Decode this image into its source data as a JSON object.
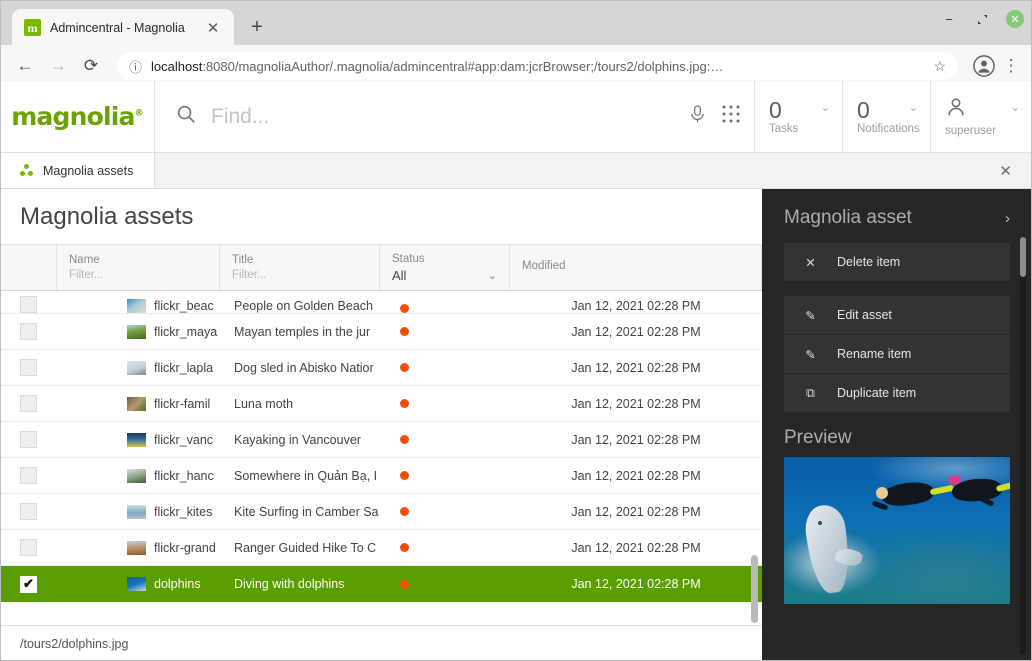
{
  "browser": {
    "tab": {
      "title": "Admincentral - Magnolia",
      "favicon_letter": "m",
      "favicon_color": "#7bb800",
      "close_label": "✕"
    },
    "new_tab_label": "+",
    "window_controls": {
      "minimize": "−",
      "maximize": "❐",
      "close": "✕"
    },
    "nav": {
      "back": "←",
      "forward": "→",
      "reload": "⟳"
    },
    "omnibox": {
      "info_icon": "ⓘ",
      "url_bold": "localhost",
      "url_rest": ":8080/magnoliaAuthor/.magnolia/admincentral#app:dam:jcrBrowser;/tours2/dolphins.jpg:…",
      "star": "☆"
    },
    "menu": "⋮"
  },
  "app": {
    "logo": {
      "text": "magnolia",
      "mark": "®",
      "color": "#6ba400"
    },
    "search": {
      "placeholder": "Find...",
      "icon": "search-icon"
    },
    "header_icons": {
      "mic": "mic-icon",
      "apps": "apps-grid-icon"
    },
    "header_cells": [
      {
        "count": "0",
        "label": "Tasks",
        "caret": "⌄"
      },
      {
        "count": "0",
        "label": "Notifications",
        "caret": "⌄"
      }
    ],
    "user": {
      "name": "superuser",
      "caret": "⌄"
    },
    "tabs": [
      {
        "label": "Magnolia assets",
        "icon": "magnolia-dots-icon"
      }
    ],
    "tabs_close": "✕"
  },
  "content": {
    "title": "Magnolia assets",
    "view_toggles": [
      {
        "name": "tree-view",
        "glyph": "tree",
        "active": true
      },
      {
        "name": "list-view",
        "glyph": "list",
        "active": false
      },
      {
        "name": "thumbnail-view",
        "glyph": "grid",
        "active": false
      }
    ],
    "table": {
      "columns": [
        {
          "label": "Name",
          "filter_placeholder": "Filter..."
        },
        {
          "label": "Title",
          "filter_placeholder": "Filter..."
        },
        {
          "label": "Status",
          "filter_value": "All",
          "caret": "⌄"
        },
        {
          "label": "Modified"
        }
      ],
      "rows": [
        {
          "name": "flickr_beac",
          "title": "People on Golden Beach",
          "status": "red",
          "modified": "Jan 12, 2021 02:28 PM",
          "selected": false,
          "thumb": "linear-gradient(145deg,#3c8fc4,#a8cbd8 45%,#e2dcc6)"
        },
        {
          "name": "flickr_maya",
          "title": "Mayan temples in the jur",
          "status": "red",
          "modified": "Jan 12, 2021 02:28 PM",
          "selected": false,
          "thumb": "linear-gradient(170deg,#b9d5e4 0%,#7aa144 40%,#3d6a1e 100%)"
        },
        {
          "name": "flickr_lapla",
          "title": "Dog sled in Abisko Natior",
          "status": "red",
          "modified": "Jan 12, 2021 02:28 PM",
          "selected": false,
          "thumb": "linear-gradient(160deg,#dfe7ec 0%,#c6cfd4 55%,#8b8278 100%)"
        },
        {
          "name": "flickr-famil",
          "title": "Luna moth",
          "status": "red",
          "modified": "Jan 12, 2021 02:28 PM",
          "selected": false,
          "thumb": "linear-gradient(135deg,#6a5a4a,#b89a6b 50%,#4c6b2a)"
        },
        {
          "name": "flickr_vanc",
          "title": "Kayaking in Vancouver",
          "status": "red",
          "modified": "Jan 12, 2021 02:28 PM",
          "selected": false,
          "thumb": "linear-gradient(180deg,#1e3550 0%,#2a6ea0 45%,#e0c23a 100%)"
        },
        {
          "name": "flickr_hanc",
          "title": "Somewhere in Quản Bạ, I",
          "status": "red",
          "modified": "Jan 12, 2021 02:28 PM",
          "selected": false,
          "thumb": "linear-gradient(165deg,#d8e2e8 0%,#8fa489 50%,#3f5a33 100%)"
        },
        {
          "name": "flickr_kites",
          "title": "Kite Surfing in Camber Sa",
          "status": "red",
          "modified": "Jan 12, 2021 02:28 PM",
          "selected": false,
          "thumb": "linear-gradient(180deg,#cfe1ea 0%,#7fa9c4 55%,#b8c3c4 100%)"
        },
        {
          "name": "flickr-grand",
          "title": "Ranger Guided Hike To C",
          "status": "red",
          "modified": "Jan 12, 2021 02:28 PM",
          "selected": false,
          "thumb": "linear-gradient(175deg,#bcd4e2 0%,#c08a5a 55%,#8a5b38 100%)"
        },
        {
          "name": "dolphins",
          "title": "Diving with dolphins",
          "status": "red",
          "modified": "Jan 12, 2021 02:28 PM",
          "selected": true,
          "thumb": "linear-gradient(160deg,#0e5f9e 0%,#1577b6 50%,#cfd8dd 100%)"
        }
      ],
      "selected_checkmark": "✔",
      "status_color": "#f54d0c",
      "selection_color": "#5a9e00"
    }
  },
  "action_panel": {
    "title": "Magnolia asset",
    "collapse_chevron": "›",
    "items": [
      {
        "label": "Delete item",
        "icon": "close-x-icon",
        "glyph": "✕"
      },
      {
        "label": "Edit asset",
        "icon": "pencil-icon",
        "glyph": "✎"
      },
      {
        "label": "Rename item",
        "icon": "pencil-icon",
        "glyph": "✎"
      },
      {
        "label": "Duplicate item",
        "icon": "duplicate-icon",
        "glyph": "⧉"
      }
    ],
    "preview_title": "Preview",
    "preview_alt": "Diving with dolphins underwater photo"
  },
  "statusbar": {
    "path": "/tours2/dolphins.jpg"
  }
}
